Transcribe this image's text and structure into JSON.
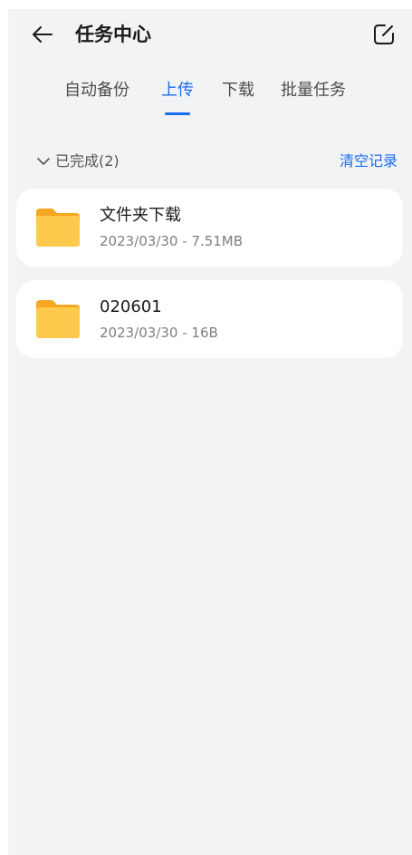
{
  "header": {
    "title": "任务中心",
    "back_icon": "arrow-left-icon",
    "edit_icon": "edit-square-icon"
  },
  "tabs": [
    {
      "label": "自动备份",
      "active": false
    },
    {
      "label": "上传",
      "active": true
    },
    {
      "label": "下载",
      "active": false
    },
    {
      "label": "批量任务",
      "active": false
    }
  ],
  "section": {
    "label": "已完成(2)",
    "clear_label": "清空记录",
    "toggle_icon": "chevron-down-icon"
  },
  "files": [
    {
      "name": "文件夹下载",
      "meta": "2023/03/30 - 7.51MB",
      "icon": "folder-icon"
    },
    {
      "name": "020601",
      "meta": "2023/03/30 - 16B",
      "icon": "folder-icon"
    }
  ],
  "colors": {
    "accent": "#1a6cf0",
    "background": "#f1f3f5",
    "folder": "#ffc94d",
    "folder_tab": "#f5a623"
  }
}
